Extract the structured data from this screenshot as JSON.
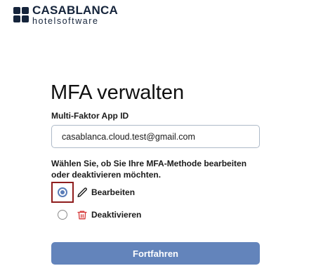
{
  "brand": {
    "name": "CASABLANCA",
    "tagline": "hotelsoftware"
  },
  "page": {
    "title": "MFA verwalten"
  },
  "mfa_app_id": {
    "label": "Multi-Faktor App ID",
    "value": "casablanca.cloud.test@gmail.com"
  },
  "question": "Wählen Sie, ob Sie Ihre MFA-Methode bearbeiten oder deaktivieren möchten.",
  "options": {
    "edit": {
      "label": "Bearbeiten",
      "selected": true,
      "icon": "pencil-icon"
    },
    "deactivate": {
      "label": "Deaktivieren",
      "selected": false,
      "icon": "trash-icon"
    }
  },
  "submit_label": "Fortfahren",
  "colors": {
    "brand": "#15243b",
    "primary": "#6384bb",
    "highlight": "#8f1d1d",
    "danger": "#d63a3a"
  }
}
